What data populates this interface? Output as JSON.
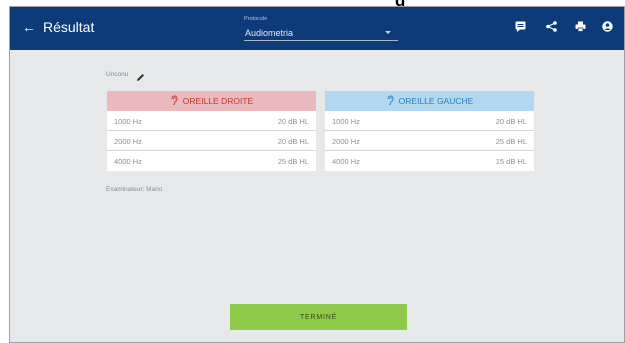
{
  "page_heading": "g",
  "header": {
    "back_icon": "arrow-left-icon",
    "title": "Résultat",
    "protocol": {
      "label": "Protocole",
      "value": "Audiometria"
    },
    "actions": [
      "comment-icon",
      "share-icon",
      "print-icon",
      "user-icon"
    ],
    "color": "#0d3a78"
  },
  "patient": {
    "name": "Unconu",
    "edit_icon": "pencil-icon"
  },
  "right_ear": {
    "title": "OREILLE DROITE",
    "icon": "ear-icon",
    "header_color": "#e9b9bd",
    "text_color": "#c0392b",
    "rows": [
      {
        "freq": "1000 Hz",
        "value": "20 dB HL"
      },
      {
        "freq": "2000 Hz",
        "value": "20 dB HL"
      },
      {
        "freq": "4000 Hz",
        "value": "25 dB HL"
      }
    ]
  },
  "left_ear": {
    "title": "OREILLE GAUCHE",
    "icon": "ear-icon",
    "header_color": "#b4d7f0",
    "text_color": "#2a7fc1",
    "rows": [
      {
        "freq": "1000 Hz",
        "value": "20 dB HL"
      },
      {
        "freq": "2000 Hz",
        "value": "25 dB HL"
      },
      {
        "freq": "4000 Hz",
        "value": "15 dB HL"
      }
    ]
  },
  "examiner": "Examinateur: Mario",
  "done_button": {
    "label": "TERMINÉ",
    "color": "#8fca4a"
  }
}
